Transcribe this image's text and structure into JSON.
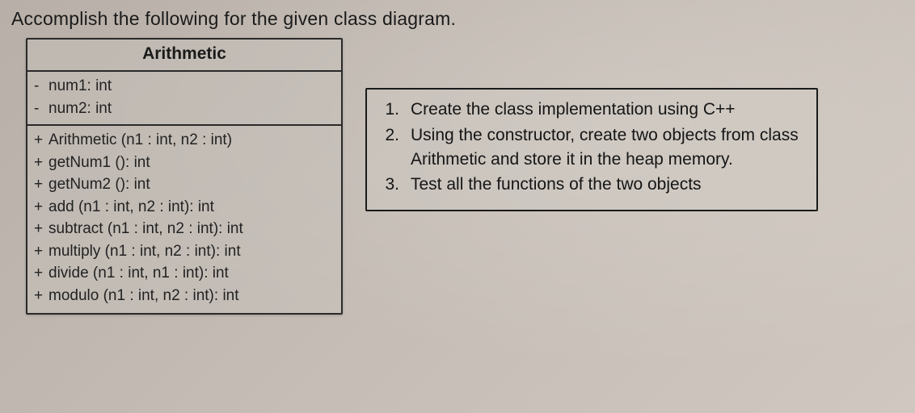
{
  "heading": "Accomplish the following for the given class diagram.",
  "uml": {
    "className": "Arithmetic",
    "attributes": [
      {
        "vis": "-",
        "sig": "num1: int"
      },
      {
        "vis": "-",
        "sig": "num2: int"
      }
    ],
    "methods": [
      {
        "vis": "+",
        "sig": "Arithmetic (n1 : int, n2 : int)"
      },
      {
        "vis": "+",
        "sig": "getNum1 (): int"
      },
      {
        "vis": "+",
        "sig": "getNum2 (): int"
      },
      {
        "vis": "+",
        "sig": "add (n1 : int, n2 : int): int"
      },
      {
        "vis": "+",
        "sig": "subtract (n1 : int, n2 : int): int"
      },
      {
        "vis": "+",
        "sig": "multiply (n1 : int, n2 : int): int"
      },
      {
        "vis": "+",
        "sig": "divide (n1 : int, n1 : int): int"
      },
      {
        "vis": "+",
        "sig": "modulo (n1 : int, n2 : int): int"
      }
    ]
  },
  "tasks": [
    "Create the class implementation using C++",
    "Using the constructor, create two objects from class Arithmetic and store it in the heap memory.",
    "Test all the functions of the two objects"
  ]
}
